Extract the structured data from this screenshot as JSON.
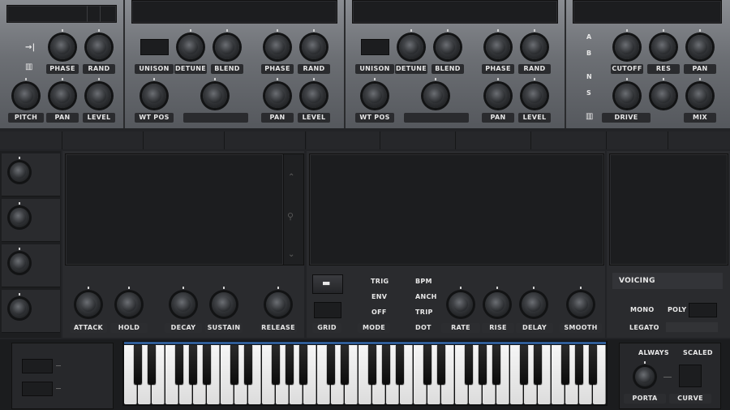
{
  "osc_left": {
    "labels": {
      "phase": "PHASE",
      "rand": "RAND",
      "pitch": "PITCH",
      "pan": "PAN",
      "level": "LEVEL"
    }
  },
  "osc_a": {
    "labels": {
      "unison": "UNISON",
      "detune": "DETUNE",
      "blend": "BLEND",
      "phase": "PHASE",
      "rand": "RAND",
      "wtpos": "WT POS",
      "pan": "PAN",
      "level": "LEVEL"
    }
  },
  "osc_b": {
    "labels": {
      "unison": "UNISON",
      "detune": "DETUNE",
      "blend": "BLEND",
      "phase": "PHASE",
      "rand": "RAND",
      "wtpos": "WT POS",
      "pan": "PAN",
      "level": "LEVEL"
    }
  },
  "filter": {
    "routes": [
      "A",
      "B",
      "N",
      "S"
    ],
    "labels": {
      "cutoff": "CUTOFF",
      "res": "RES",
      "pan": "PAN",
      "drive": "DRIVE",
      "mix": "MIX"
    }
  },
  "env": {
    "labels": {
      "attack": "ATTACK",
      "hold": "HOLD",
      "decay": "DECAY",
      "sustain": "SUSTAIN",
      "release": "RELEASE"
    }
  },
  "lfo": {
    "modes": [
      "TRIG",
      "ENV",
      "OFF"
    ],
    "grid": "GRID",
    "mode": "MODE",
    "sync": [
      "BPM",
      "ANCH",
      "TRIP",
      "DOT"
    ],
    "labels": {
      "rate": "RATE",
      "rise": "RISE",
      "delay": "DELAY",
      "smooth": "SMOOTH"
    }
  },
  "voicing": {
    "title": "VOICING",
    "mono": "MONO",
    "poly": "POLY",
    "legato": "LEGATO"
  },
  "porta": {
    "always": "ALWAYS",
    "scaled": "SCALED",
    "porta": "PORTA",
    "curve": "CURVE"
  },
  "colors": {
    "accent_blue": "#3f7fd0",
    "panel_metal": "#6c6f74",
    "panel_dark": "#1f2022"
  }
}
